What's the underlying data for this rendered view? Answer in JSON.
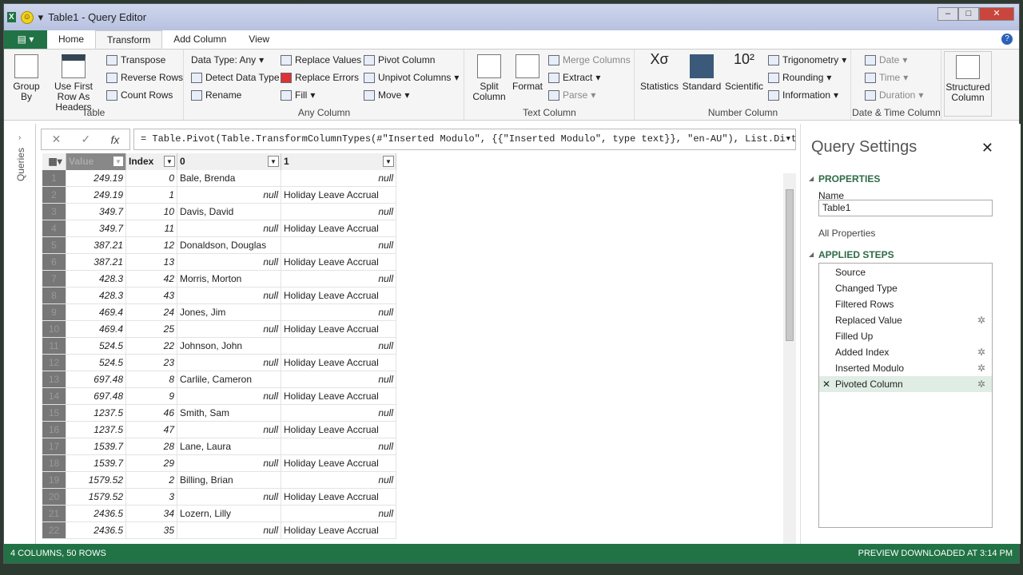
{
  "title": "Table1 - Query Editor",
  "tabs": [
    "Home",
    "Transform",
    "Add Column",
    "View"
  ],
  "active_tab": "Transform",
  "ribbon": {
    "table": {
      "group_by": "Group By",
      "use_first_row": "Use First Row As Headers",
      "transpose": "Transpose",
      "reverse_rows": "Reverse Rows",
      "count_rows": "Count Rows",
      "label": "Table"
    },
    "any_column": {
      "data_type": "Data Type: Any",
      "detect": "Detect Data Type",
      "rename": "Rename",
      "replace_values": "Replace Values",
      "replace_errors": "Replace Errors",
      "fill": "Fill",
      "pivot": "Pivot Column",
      "unpivot": "Unpivot Columns",
      "move": "Move",
      "label": "Any Column"
    },
    "text_column": {
      "split": "Split Column",
      "format": "Format",
      "merge": "Merge Columns",
      "extract": "Extract",
      "parse": "Parse",
      "label": "Text Column"
    },
    "number_column": {
      "statistics": "Statistics",
      "standard": "Standard",
      "scientific": "Scientific",
      "trig": "Trigonometry",
      "rounding": "Rounding",
      "information": "Information",
      "label": "Number Column"
    },
    "datetime": {
      "date": "Date",
      "time": "Time",
      "duration": "Duration",
      "label": "Date & Time Column"
    },
    "structured": "Structured Column"
  },
  "queries_label": "Queries",
  "formula": "= Table.Pivot(Table.TransformColumnTypes(#\"Inserted Modulo\", {{\"Inserted Modulo\", type text}}, \"en-AU\"), List.Distinct",
  "columns": [
    "Value",
    "Index",
    "0",
    "1"
  ],
  "rows": [
    [
      "1",
      "249.19",
      "0",
      "Bale, Brenda",
      "null"
    ],
    [
      "2",
      "249.19",
      "1",
      "null",
      "Holiday Leave Accrual"
    ],
    [
      "3",
      "349.7",
      "10",
      "Davis, David",
      "null"
    ],
    [
      "4",
      "349.7",
      "11",
      "null",
      "Holiday Leave Accrual"
    ],
    [
      "5",
      "387.21",
      "12",
      "Donaldson, Douglas",
      "null"
    ],
    [
      "6",
      "387.21",
      "13",
      "null",
      "Holiday Leave Accrual"
    ],
    [
      "7",
      "428.3",
      "42",
      "Morris, Morton",
      "null"
    ],
    [
      "8",
      "428.3",
      "43",
      "null",
      "Holiday Leave Accrual"
    ],
    [
      "9",
      "469.4",
      "24",
      "Jones, Jim",
      "null"
    ],
    [
      "10",
      "469.4",
      "25",
      "null",
      "Holiday Leave Accrual"
    ],
    [
      "11",
      "524.5",
      "22",
      "Johnson, John",
      "null"
    ],
    [
      "12",
      "524.5",
      "23",
      "null",
      "Holiday Leave Accrual"
    ],
    [
      "13",
      "697.48",
      "8",
      "Carlile, Cameron",
      "null"
    ],
    [
      "14",
      "697.48",
      "9",
      "null",
      "Holiday Leave Accrual"
    ],
    [
      "15",
      "1237.5",
      "46",
      "Smith, Sam",
      "null"
    ],
    [
      "16",
      "1237.5",
      "47",
      "null",
      "Holiday Leave Accrual"
    ],
    [
      "17",
      "1539.7",
      "28",
      "Lane, Laura",
      "null"
    ],
    [
      "18",
      "1539.7",
      "29",
      "null",
      "Holiday Leave Accrual"
    ],
    [
      "19",
      "1579.52",
      "2",
      "Billing, Brian",
      "null"
    ],
    [
      "20",
      "1579.52",
      "3",
      "null",
      "Holiday Leave Accrual"
    ],
    [
      "21",
      "2436.5",
      "34",
      "Lozern, Lilly",
      "null"
    ],
    [
      "22",
      "2436.5",
      "35",
      "null",
      "Holiday Leave Accrual"
    ]
  ],
  "settings": {
    "title": "Query Settings",
    "properties": "PROPERTIES",
    "name_label": "Name",
    "name_value": "Table1",
    "all_properties": "All Properties",
    "applied_steps": "APPLIED STEPS",
    "steps": [
      {
        "name": "Source",
        "gear": false
      },
      {
        "name": "Changed Type",
        "gear": false
      },
      {
        "name": "Filtered Rows",
        "gear": false
      },
      {
        "name": "Replaced Value",
        "gear": true
      },
      {
        "name": "Filled Up",
        "gear": false
      },
      {
        "name": "Added Index",
        "gear": true
      },
      {
        "name": "Inserted Modulo",
        "gear": true
      },
      {
        "name": "Pivoted Column",
        "gear": true,
        "selected": true
      }
    ]
  },
  "status": {
    "left": "4 COLUMNS, 50 ROWS",
    "right": "PREVIEW DOWNLOADED AT 3:14 PM"
  },
  "accent": "#217346"
}
